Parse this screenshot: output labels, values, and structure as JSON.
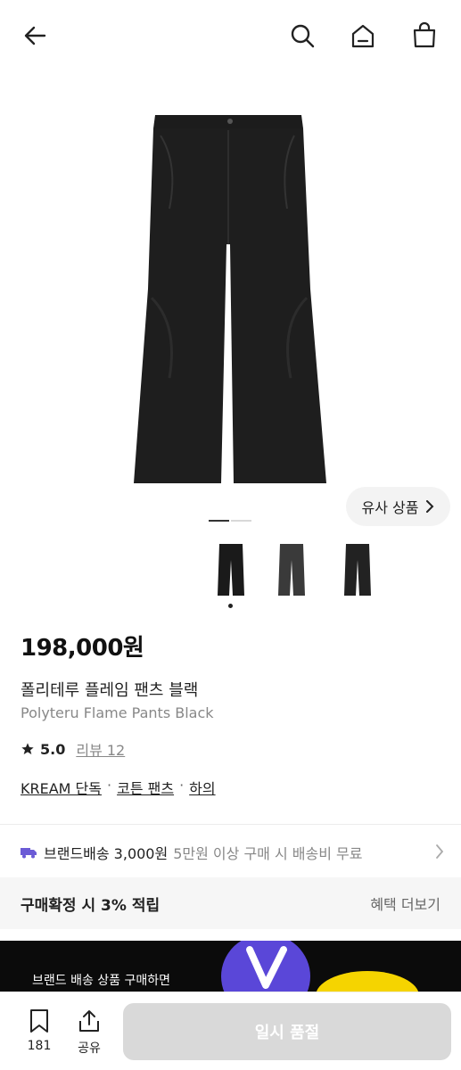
{
  "product": {
    "price": "198,000원",
    "name_ko": "폴리테루 플레임 팬츠 블랙",
    "name_en": "Polyteru Flame Pants Black",
    "rating": "5.0",
    "review_label": "리뷰 12",
    "tags": [
      "KREAM 단독",
      "코튼 팬츠",
      "하의"
    ],
    "tag_separator": "·"
  },
  "hero": {
    "similar_button": "유사 상품",
    "image_color": "#1e1e1e",
    "indicator_total": 2,
    "indicator_active": 1
  },
  "thumbnails": [
    {
      "name": "thumb-black",
      "color": "#1a1a1a"
    },
    {
      "name": "thumb-charcoal",
      "color": "#3a3a3a"
    },
    {
      "name": "thumb-dark",
      "color": "#222222"
    }
  ],
  "shipping": {
    "label": "브랜드배송 3,000원",
    "note": "5만원 이상 구매 시 배송비 무료",
    "icon": "truck-icon"
  },
  "benefit": {
    "title": "구매확정 시 3% 적립",
    "more": "혜택 더보기"
  },
  "banner": {
    "text": "브랜드 배송 상품 구매하면"
  },
  "bottom_bar": {
    "bookmark_count": "181",
    "share_label": "공유",
    "action_label": "일시 품절"
  },
  "colors": {
    "accent_purple": "#6b5bd6",
    "disabled_button": "#d9d9d9"
  }
}
